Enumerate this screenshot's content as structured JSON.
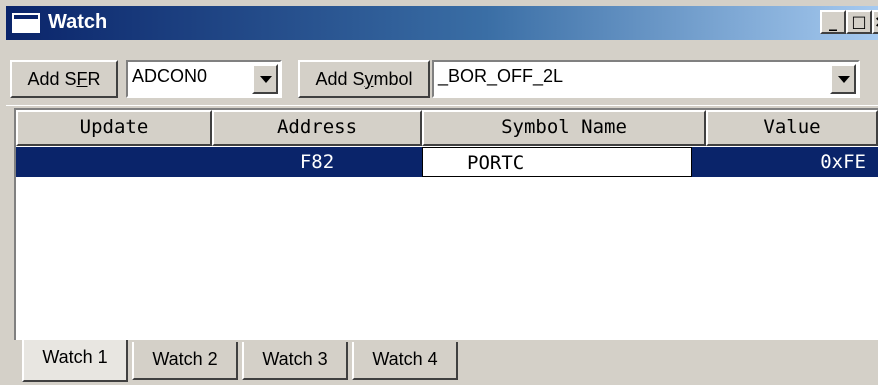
{
  "window": {
    "title": "Watch",
    "min_glyph": "_",
    "max_glyph": "□",
    "close_glyph": "×"
  },
  "toolbar": {
    "add_sfr_label_pre": "Add S",
    "add_sfr_label_ul": "F",
    "add_sfr_label_post": "R",
    "sfr_combo_value": "ADCON0",
    "add_symbol_label_pre": "Add S",
    "add_symbol_label_ul": "y",
    "add_symbol_label_post": "mbol",
    "symbol_combo_value": "_BOR_OFF_2L"
  },
  "grid": {
    "columns": [
      "Update",
      "Address",
      "Symbol Name",
      "Value"
    ],
    "rows": [
      {
        "update": "",
        "address": "F82",
        "symbol": "PORTC",
        "value": "0xFE"
      }
    ]
  },
  "tabs": [
    "Watch 1",
    "Watch 2",
    "Watch 3",
    "Watch 4"
  ],
  "colors": {
    "selection": "#0a246a",
    "face": "#d4d0c8",
    "title_start": "#0a246a"
  }
}
